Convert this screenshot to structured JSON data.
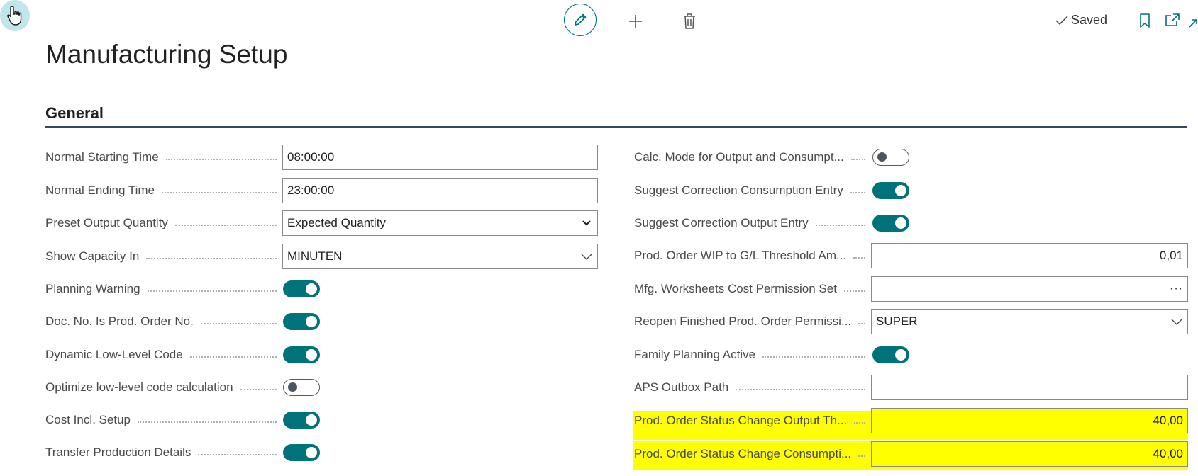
{
  "toolbar": {
    "saved_label": "Saved",
    "icons": [
      "hand-cursor-icon",
      "pencil-icon",
      "plus-icon",
      "trash-icon",
      "checkmark-icon",
      "bookmark-icon",
      "open-in-new-window-icon",
      "collapse-icon"
    ]
  },
  "page": {
    "title": "Manufacturing Setup"
  },
  "section": {
    "title": "General"
  },
  "left_fields": [
    {
      "label": "Normal Starting Time",
      "type": "text",
      "value": "08:00:00"
    },
    {
      "label": "Normal Ending Time",
      "type": "text",
      "value": "23:00:00"
    },
    {
      "label": "Preset Output Quantity",
      "type": "select",
      "value": "Expected Quantity"
    },
    {
      "label": "Show Capacity In",
      "type": "lookup",
      "value": "MINUTEN"
    },
    {
      "label": "Planning Warning",
      "type": "toggle",
      "on": true
    },
    {
      "label": "Doc. No. Is Prod. Order No.",
      "type": "toggle",
      "on": true
    },
    {
      "label": "Dynamic Low-Level Code",
      "type": "toggle",
      "on": true
    },
    {
      "label": "Optimize low-level code calculation",
      "type": "toggle",
      "on": false
    },
    {
      "label": "Cost Incl. Setup",
      "type": "toggle",
      "on": true
    },
    {
      "label": "Transfer Production Details",
      "type": "toggle",
      "on": true
    }
  ],
  "right_fields": [
    {
      "label": "Calc. Mode for Output and Consumpt...",
      "type": "toggle",
      "on": false
    },
    {
      "label": "Suggest Correction Consumption Entry",
      "type": "toggle",
      "on": true
    },
    {
      "label": "Suggest Correction Output Entry",
      "type": "toggle",
      "on": true
    },
    {
      "label": "Prod. Order WIP to G/L Threshold Am...",
      "type": "number",
      "value": "0,01"
    },
    {
      "label": "Mfg. Worksheets Cost Permission Set",
      "type": "assist",
      "value": "",
      "assist_label": "···"
    },
    {
      "label": "Reopen Finished Prod. Order Permissi...",
      "type": "lookup",
      "value": "SUPER"
    },
    {
      "label": "Family Planning Active",
      "type": "toggle",
      "on": true
    },
    {
      "label": "APS Outbox Path",
      "type": "text",
      "value": ""
    },
    {
      "label": "Prod. Order Status Change Output Th...",
      "type": "number",
      "value": "40,00",
      "highlight": true
    },
    {
      "label": "Prod. Order Status Change Consumpti...",
      "type": "number",
      "value": "40,00",
      "highlight": true
    }
  ],
  "colors": {
    "accent": "#00737a",
    "highlight": "#ffff00",
    "cursor_badge": "#bfe6ea"
  }
}
